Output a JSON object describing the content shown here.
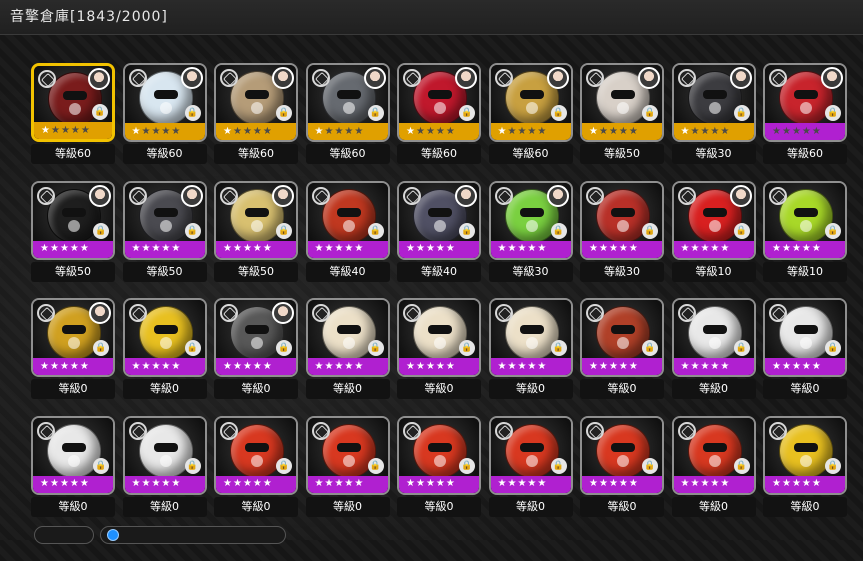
{
  "header": {
    "title": "音擎倉庫[1843/2000]"
  },
  "colors": {
    "gold_frame": "#f2c200",
    "gold_band": "#e0a000",
    "purple_band": "#b020d0"
  },
  "items": [
    {
      "level": "等級60",
      "stars": 1,
      "rarity": "gold",
      "avatar": true,
      "locked": true,
      "color": "#7a1c1c",
      "icon": "wrench-gauntlet-icon",
      "selected": true
    },
    {
      "level": "等級60",
      "stars": 1,
      "rarity": "gold",
      "avatar": true,
      "locked": true,
      "color": "#d8e6f0",
      "icon": "shark-icon"
    },
    {
      "level": "等級60",
      "stars": 1,
      "rarity": "gold",
      "avatar": true,
      "locked": true,
      "color": "#b59c78",
      "icon": "house-icon"
    },
    {
      "level": "等級60",
      "stars": 1,
      "rarity": "gold",
      "avatar": true,
      "locked": true,
      "color": "#666a70",
      "icon": "dark-orb-icon"
    },
    {
      "level": "等級60",
      "stars": 1,
      "rarity": "gold",
      "avatar": true,
      "locked": true,
      "color": "#c0182c",
      "icon": "red-armor-icon"
    },
    {
      "level": "等級60",
      "stars": 1,
      "rarity": "gold",
      "avatar": true,
      "locked": true,
      "color": "#c8a040",
      "icon": "birdcage-icon"
    },
    {
      "level": "等級50",
      "stars": 1,
      "rarity": "gold",
      "avatar": true,
      "locked": true,
      "color": "#d8d0c8",
      "icon": "robot-icon"
    },
    {
      "level": "等級30",
      "stars": 1,
      "rarity": "gold",
      "avatar": true,
      "locked": true,
      "color": "#3c3c40",
      "icon": "grey-robot-icon"
    },
    {
      "level": "等級60",
      "stars": 0,
      "rarity": "purple",
      "avatar": true,
      "locked": true,
      "color": "#c8242c",
      "icon": "red-robot-icon"
    },
    {
      "level": "等級50",
      "stars": 5,
      "rarity": "purple",
      "avatar": true,
      "locked": true,
      "color": "#1e1e1e",
      "icon": "helmet-icon"
    },
    {
      "level": "等級50",
      "stars": 5,
      "rarity": "purple",
      "avatar": true,
      "locked": true,
      "color": "#4a4a50",
      "icon": "mech-icon"
    },
    {
      "level": "等級50",
      "stars": 5,
      "rarity": "purple",
      "avatar": true,
      "locked": true,
      "color": "#d8c070",
      "icon": "drill-icon"
    },
    {
      "level": "等級40",
      "stars": 5,
      "rarity": "purple",
      "avatar": false,
      "locked": true,
      "color": "#c03820",
      "icon": "furnace-icon"
    },
    {
      "level": "等級40",
      "stars": 5,
      "rarity": "purple",
      "avatar": true,
      "locked": true,
      "color": "#505064",
      "icon": "hammer-icon"
    },
    {
      "level": "等級30",
      "stars": 5,
      "rarity": "purple",
      "avatar": true,
      "locked": true,
      "color": "#7ad040",
      "icon": "green-monster-icon"
    },
    {
      "level": "等級30",
      "stars": 5,
      "rarity": "purple",
      "avatar": false,
      "locked": true,
      "color": "#b83028",
      "icon": "bangboo-icon"
    },
    {
      "level": "等級10",
      "stars": 5,
      "rarity": "purple",
      "avatar": true,
      "locked": true,
      "color": "#d82020",
      "icon": "red-ball-icon"
    },
    {
      "level": "等級10",
      "stars": 5,
      "rarity": "purple",
      "avatar": false,
      "locked": true,
      "color": "#a8d828",
      "icon": "green-ball-icon"
    },
    {
      "level": "等級0",
      "stars": 5,
      "rarity": "purple",
      "avatar": true,
      "locked": true,
      "color": "#d0a020",
      "icon": "star-orb-icon"
    },
    {
      "level": "等級0",
      "stars": 5,
      "rarity": "purple",
      "avatar": false,
      "locked": true,
      "color": "#e8c020",
      "icon": "yellow-orb-icon"
    },
    {
      "level": "等級0",
      "stars": 5,
      "rarity": "purple",
      "avatar": true,
      "locked": true,
      "color": "#585858",
      "icon": "visor-orb-icon"
    },
    {
      "level": "等級0",
      "stars": 5,
      "rarity": "purple",
      "avatar": false,
      "locked": true,
      "color": "#ece0c8",
      "icon": "cream-bangboo-icon"
    },
    {
      "level": "等級0",
      "stars": 5,
      "rarity": "purple",
      "avatar": false,
      "locked": true,
      "color": "#ece0c8",
      "icon": "cream-bangboo-icon"
    },
    {
      "level": "等級0",
      "stars": 5,
      "rarity": "purple",
      "avatar": false,
      "locked": true,
      "color": "#ece0c8",
      "icon": "cream-bangboo-icon"
    },
    {
      "level": "等級0",
      "stars": 5,
      "rarity": "purple",
      "avatar": false,
      "locked": true,
      "color": "#b04028",
      "icon": "jukebox-icon"
    },
    {
      "level": "等級0",
      "stars": 5,
      "rarity": "purple",
      "avatar": false,
      "locked": true,
      "color": "#e8e8e8",
      "icon": "panda-robot-icon"
    },
    {
      "level": "等級0",
      "stars": 5,
      "rarity": "purple",
      "avatar": false,
      "locked": true,
      "color": "#e8e8e8",
      "icon": "panda-robot-icon"
    },
    {
      "level": "等級0",
      "stars": 5,
      "rarity": "purple",
      "avatar": false,
      "locked": true,
      "color": "#e8e8e8",
      "icon": "panda-robot-icon"
    },
    {
      "level": "等級0",
      "stars": 5,
      "rarity": "purple",
      "avatar": false,
      "locked": true,
      "color": "#e8e8e8",
      "icon": "panda-robot-icon"
    },
    {
      "level": "等級0",
      "stars": 5,
      "rarity": "purple",
      "avatar": false,
      "locked": true,
      "color": "#d83820",
      "icon": "red-spike-icon"
    },
    {
      "level": "等級0",
      "stars": 5,
      "rarity": "purple",
      "avatar": false,
      "locked": true,
      "color": "#d83820",
      "icon": "red-spike-icon"
    },
    {
      "level": "等級0",
      "stars": 5,
      "rarity": "purple",
      "avatar": false,
      "locked": true,
      "color": "#d83820",
      "icon": "red-spike-icon"
    },
    {
      "level": "等級0",
      "stars": 5,
      "rarity": "purple",
      "avatar": false,
      "locked": true,
      "color": "#d83820",
      "icon": "red-spike-icon"
    },
    {
      "level": "等級0",
      "stars": 5,
      "rarity": "purple",
      "avatar": false,
      "locked": true,
      "color": "#d83820",
      "icon": "red-spike-icon"
    },
    {
      "level": "等級0",
      "stars": 5,
      "rarity": "purple",
      "avatar": false,
      "locked": true,
      "color": "#d83820",
      "icon": "red-spike-icon"
    },
    {
      "level": "等級0",
      "stars": 5,
      "rarity": "purple",
      "avatar": false,
      "locked": true,
      "color": "#e8c020",
      "icon": "yellow-orb-icon"
    }
  ],
  "footer": {
    "sort_label": ""
  }
}
